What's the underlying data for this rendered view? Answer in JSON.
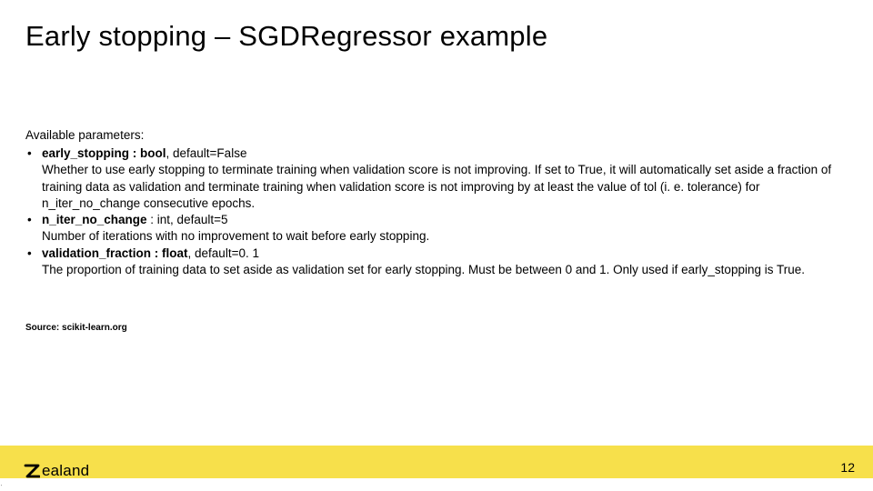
{
  "title": "Early stopping – SGDRegressor example",
  "intro": "Available parameters:",
  "params": [
    {
      "label": "early_stopping : bool",
      "default": ", default=False",
      "desc": "Whether to use early stopping to terminate training when validation score is not improving. If set to True, it will automatically set aside a fraction of training data as validation and terminate training when validation score is not improving by at least the value of tol (i. e. tolerance) for n_iter_no_change consecutive epochs."
    },
    {
      "label": "n_iter_no_change",
      "default": " : int, default=5",
      "desc": "Number of iterations with no improvement to wait before early stopping."
    },
    {
      "label": "validation_fraction :  float",
      "default": ", default=0. 1",
      "desc": "The proportion of training data to set aside as validation set for early stopping. Must be between 0 and 1. Only used if early_stopping is True."
    }
  ],
  "source": "Source: scikit-learn.org",
  "logo_text": "ealand",
  "page_number": "12",
  "tiny_mark": "'"
}
